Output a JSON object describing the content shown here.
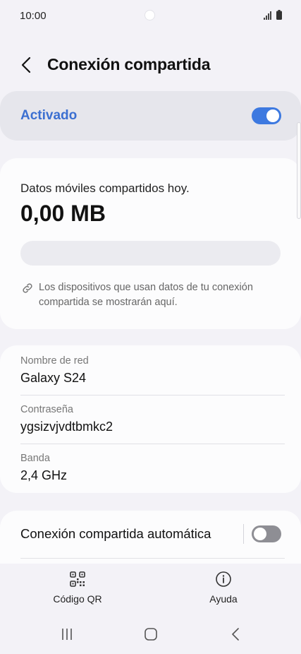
{
  "status_bar": {
    "time": "10:00"
  },
  "header": {
    "title": "Conexión compartida"
  },
  "master_switch": {
    "label": "Activado",
    "on": true
  },
  "data_usage": {
    "caption": "Datos móviles compartidos hoy.",
    "amount": "0,00 MB",
    "progress_fraction": 0,
    "note": "Los dispositivos que usan datos de tu conexión compartida se mostrarán aquí."
  },
  "network": {
    "name_label": "Nombre de red",
    "name_value": "Galaxy S24",
    "password_label": "Contraseña",
    "password_value": "ygsizvjvdtbmkc2",
    "band_label": "Banda",
    "band_value": "2,4 GHz"
  },
  "auto_hotspot": {
    "label": "Conexión compartida automática",
    "on": false
  },
  "bottom_actions": {
    "qr_label": "Código QR",
    "help_label": "Ayuda"
  },
  "colors": {
    "accent": "#3d79e0",
    "accent_text": "#3b6fd1",
    "toggle_off": "#8e8e94"
  },
  "icons": {
    "back": "chevron-left-icon",
    "link": "link-icon",
    "qr": "qr-code-icon",
    "help": "info-icon",
    "recents": "recent-apps-icon",
    "home": "home-icon",
    "nav_back": "back-icon"
  }
}
